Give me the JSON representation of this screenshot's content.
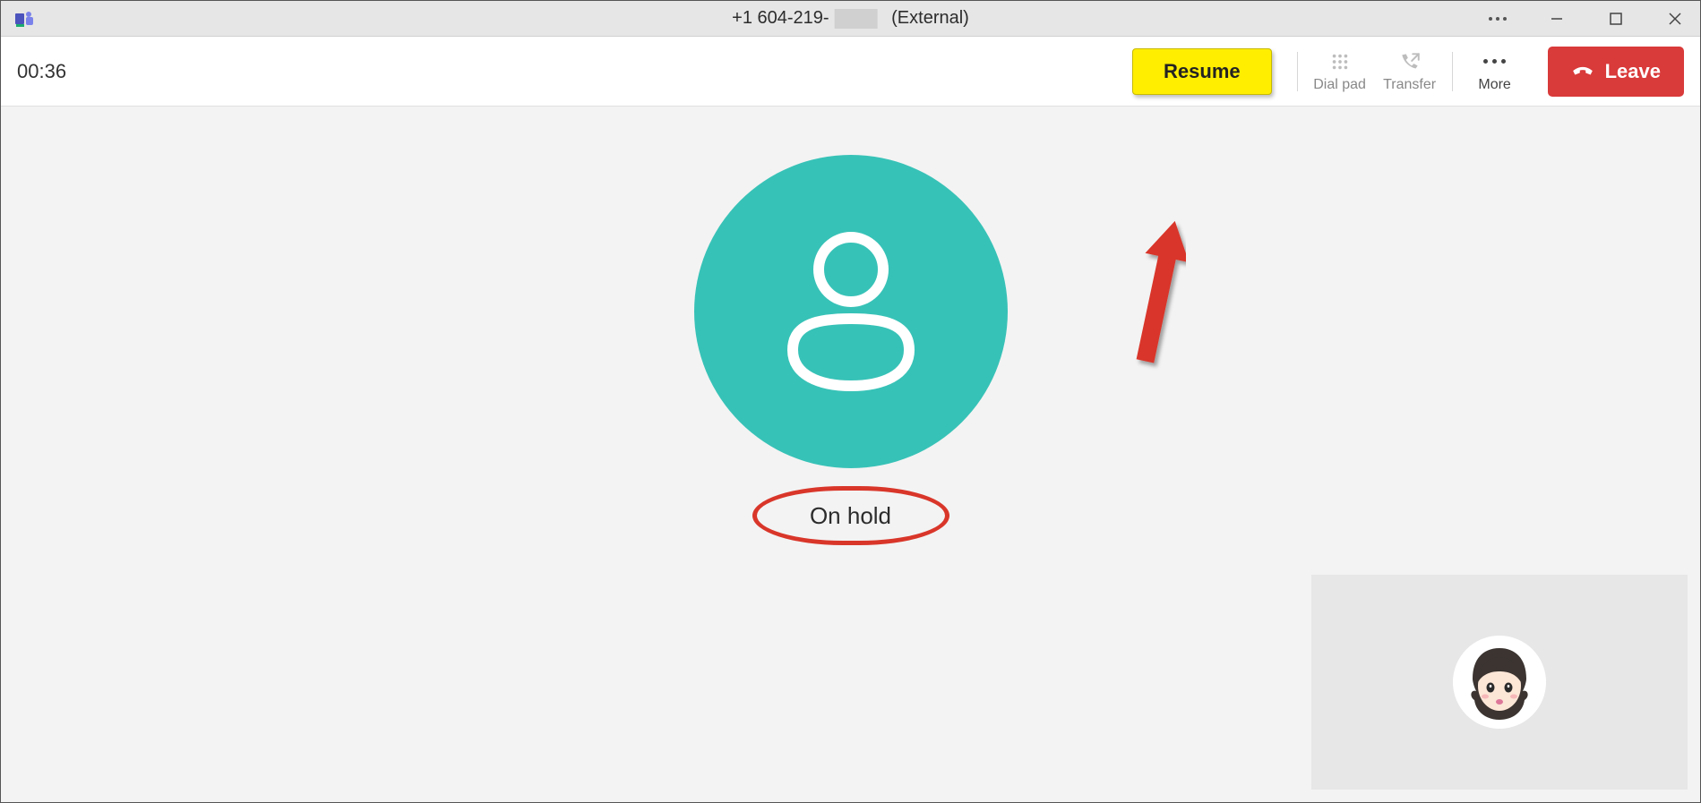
{
  "titlebar": {
    "phone_prefix": "+1 604-219-",
    "external_label": "(External)"
  },
  "toolbar": {
    "timer": "00:36",
    "resume_label": "Resume",
    "dialpad_label": "Dial pad",
    "transfer_label": "Transfer",
    "more_label": "More",
    "leave_label": "Leave"
  },
  "call": {
    "status": "On hold"
  },
  "colors": {
    "resume_bg": "#ffee00",
    "leave_bg": "#d93a3a",
    "avatar_bg": "#37c2b7",
    "annotation": "#d9362a"
  }
}
